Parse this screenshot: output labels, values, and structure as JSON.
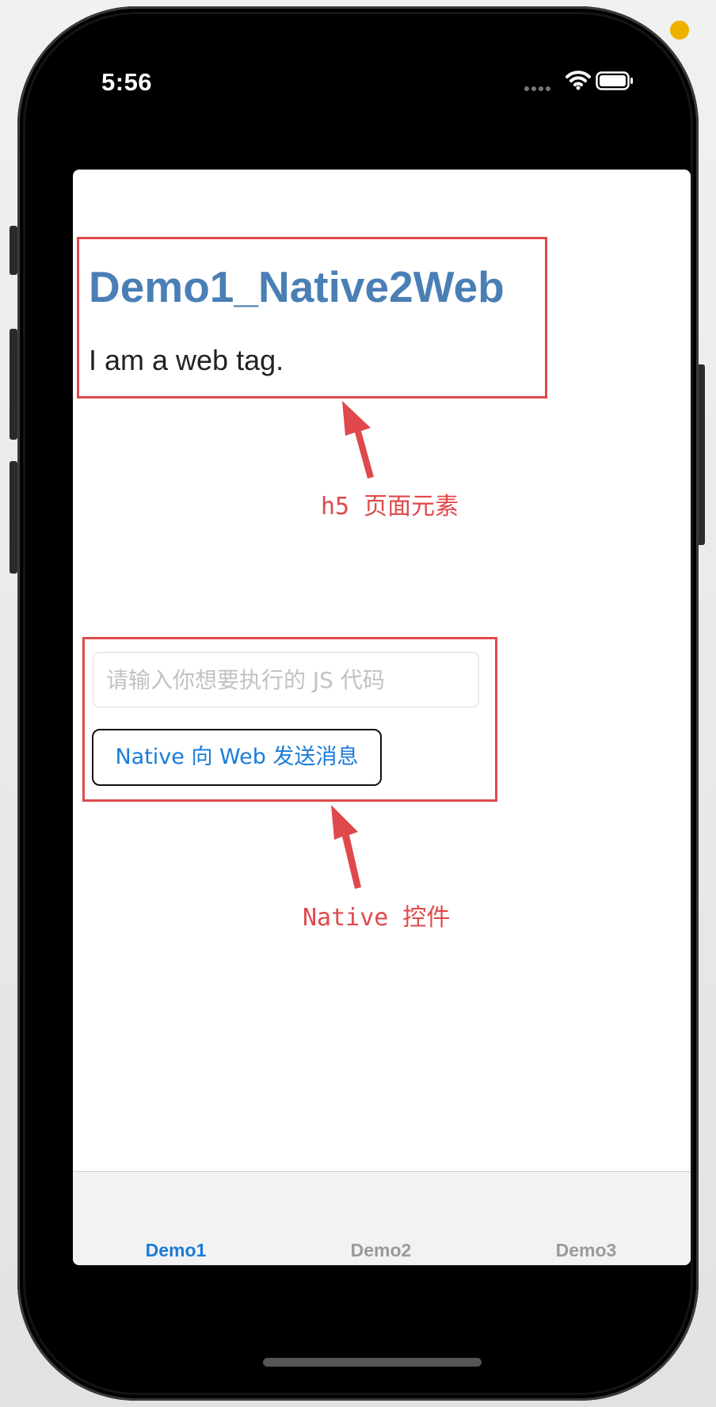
{
  "status_bar": {
    "time": "5:56",
    "icons": [
      "signal-dots-icon",
      "wifi-icon",
      "battery-icon"
    ]
  },
  "web": {
    "title": "Demo1_Native2Web",
    "paragraph": "I am a web tag."
  },
  "native": {
    "input_value": "",
    "input_placeholder": "请输入你想要执行的 JS 代码",
    "button_label": "Native 向 Web 发送消息"
  },
  "annotations": {
    "web_label": "h5 页面元素",
    "native_label": "Native 控件"
  },
  "tabbar": {
    "tabs": [
      {
        "label": "Demo1",
        "active": true
      },
      {
        "label": "Demo2",
        "active": false
      },
      {
        "label": "Demo3",
        "active": false
      }
    ]
  },
  "colors": {
    "annotation_red": "#e0494c",
    "title_blue": "#4a7fb5",
    "accent_blue": "#1a7cd8",
    "tab_inactive": "#9a9a9a",
    "tabbar_bg": "#f2f2f2"
  }
}
